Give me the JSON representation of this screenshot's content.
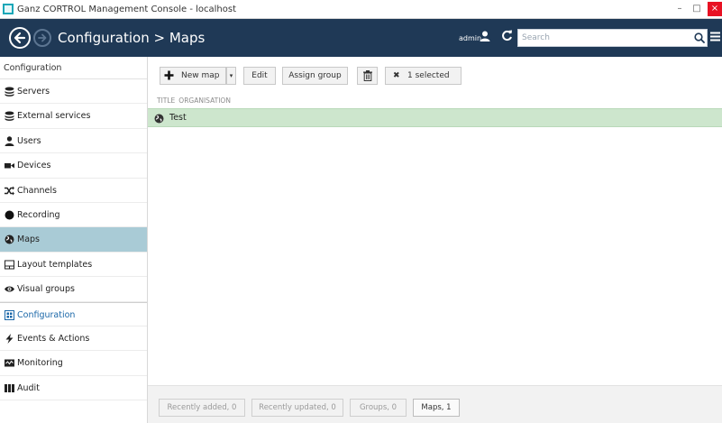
{
  "window": {
    "title": "Ganz CORTROL Management Console - localhost",
    "min_label": "–",
    "max_label": "□",
    "close_label": "×"
  },
  "header": {
    "title": "Configuration > Maps",
    "user": "admin",
    "search_placeholder": "Search"
  },
  "sidebar": {
    "header": "Configuration",
    "items": [
      {
        "label": "Servers",
        "icon": "servers-icon"
      },
      {
        "label": "External services",
        "icon": "external-services-icon"
      },
      {
        "label": "Users",
        "icon": "user-icon"
      },
      {
        "label": "Devices",
        "icon": "camera-icon"
      },
      {
        "label": "Channels",
        "icon": "shuffle-icon"
      },
      {
        "label": "Recording",
        "icon": "record-icon"
      },
      {
        "label": "Maps",
        "icon": "globe-icon",
        "active": true
      },
      {
        "label": "Layout templates",
        "icon": "layout-icon"
      },
      {
        "label": "Visual groups",
        "icon": "eye-icon"
      }
    ],
    "sections": [
      {
        "label": "Configuration",
        "icon": "configuration-icon"
      },
      {
        "label": "Events & Actions",
        "icon": "lightning-icon"
      },
      {
        "label": "Monitoring",
        "icon": "monitoring-icon"
      },
      {
        "label": "Audit",
        "icon": "audit-icon"
      }
    ]
  },
  "toolbar": {
    "new_map": "New map",
    "dropdown": "▾",
    "edit": "Edit",
    "assign_group": "Assign group",
    "selected": "1 selected",
    "selected_x": "✖"
  },
  "table": {
    "columns": [
      "TITLE",
      "ORGANISATION"
    ],
    "rows": [
      {
        "title": "Test",
        "organisation": ""
      }
    ]
  },
  "footer": {
    "recently_added": "Recently added, 0",
    "recently_updated": "Recently updated, 0",
    "groups": "Groups, 0",
    "maps": "Maps, 1"
  },
  "colors": {
    "header_bg": "#1f3956",
    "active_item": "#a9cbd6",
    "selected_row": "#cde6cd",
    "section_link": "#1a67a8"
  }
}
